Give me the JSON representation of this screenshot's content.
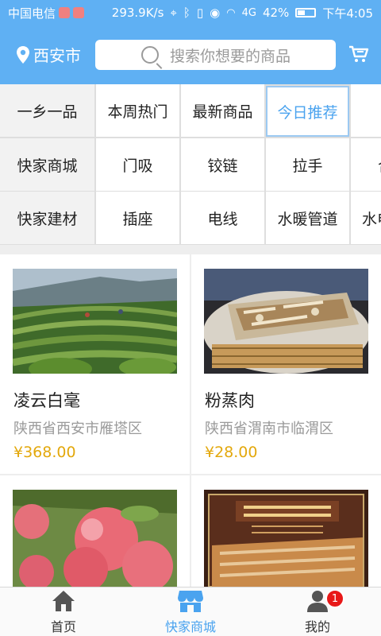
{
  "status_bar": {
    "carrier": "中国电信",
    "speed": "293.9K/s",
    "network": "4G",
    "battery": "42%",
    "time": "下午4:05"
  },
  "header": {
    "city": "西安市",
    "search_placeholder": "搜索你想要的商品",
    "icons": {
      "location": "location-pin-icon",
      "search": "search-icon",
      "cart": "cart-icon"
    }
  },
  "categories": {
    "rows": [
      {
        "head": "一乡一品",
        "items": [
          "本周热门",
          "最新商品",
          "今日推荐"
        ]
      },
      {
        "head": "快家商城",
        "items": [
          "门吸",
          "铰链",
          "拉手",
          "合"
        ]
      },
      {
        "head": "快家建材",
        "items": [
          "插座",
          "电线",
          "水暖管道",
          "水电"
        ]
      }
    ],
    "active": "今日推荐"
  },
  "products": [
    {
      "name": "凌云白毫",
      "location": "陕西省西安市雁塔区",
      "price": "¥368.00"
    },
    {
      "name": "粉蒸肉",
      "location": "陕西省渭南市临渭区",
      "price": "¥28.00"
    },
    {
      "name": "",
      "location": "",
      "price": ""
    },
    {
      "name": "",
      "location": "",
      "price": ""
    }
  ],
  "bottom_nav": {
    "tabs": [
      {
        "label": "首页",
        "icon": "home-icon"
      },
      {
        "label": "快家商城",
        "icon": "store-icon"
      },
      {
        "label": "我的",
        "icon": "user-icon",
        "badge": "1"
      }
    ],
    "active": "快家商城"
  },
  "colors": {
    "primary": "#5fb0f3",
    "accent_text": "#4aa3ef",
    "price": "#e3a80c",
    "badge": "#e81818"
  }
}
